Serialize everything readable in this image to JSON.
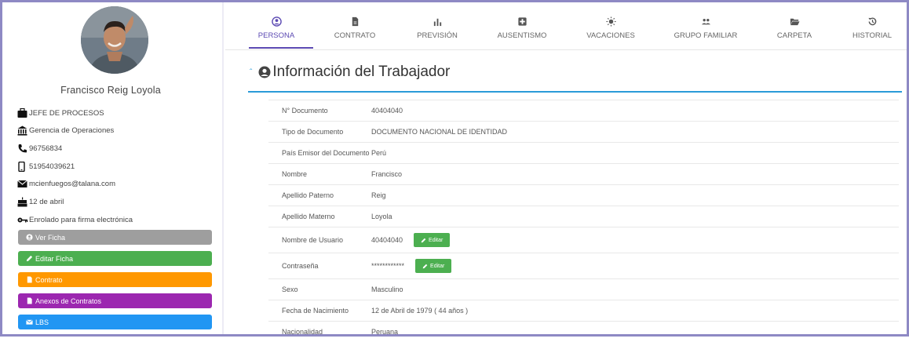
{
  "profile": {
    "name": "Francisco Reig Loyola",
    "info": [
      {
        "icon": "briefcase-icon",
        "text": "JEFE DE PROCESOS"
      },
      {
        "icon": "bank-icon",
        "text": "Gerencia de Operaciones"
      },
      {
        "icon": "phone-icon",
        "text": "96756834"
      },
      {
        "icon": "mobile-icon",
        "text": "51954039621"
      },
      {
        "icon": "envelope-icon",
        "text": "mcienfuegos@talana.com"
      },
      {
        "icon": "cake-icon",
        "text": "12 de abril"
      },
      {
        "icon": "key-icon",
        "text": "Enrolado para firma electrónica"
      }
    ],
    "buttons": [
      {
        "label": "Ver Ficha",
        "icon": "user-circle-icon",
        "color": "#9e9e9e"
      },
      {
        "label": "Editar Ficha",
        "icon": "pencil-icon",
        "color": "#4caf50"
      },
      {
        "label": "Contrato",
        "icon": "document-icon",
        "color": "#ff9800"
      },
      {
        "label": "Anexos de Contratos",
        "icon": "document-icon",
        "color": "#9c27b0"
      },
      {
        "label": "LBS",
        "icon": "envelope-icon",
        "color": "#2196f3"
      }
    ]
  },
  "tabs": [
    {
      "label": "PERSONA",
      "icon": "user-circle-icon",
      "active": true
    },
    {
      "label": "CONTRATO",
      "icon": "document-icon",
      "active": false
    },
    {
      "label": "PREVISIÓN",
      "icon": "bar-chart-icon",
      "active": false
    },
    {
      "label": "AUSENTISMO",
      "icon": "medical-plus-icon",
      "active": false
    },
    {
      "label": "VACACIONES",
      "icon": "sun-icon",
      "active": false
    },
    {
      "label": "GRUPO FAMILIAR",
      "icon": "family-icon",
      "active": false
    },
    {
      "label": "CARPETA",
      "icon": "folder-open-icon",
      "active": false
    },
    {
      "label": "HISTORIAL",
      "icon": "history-icon",
      "active": false
    }
  ],
  "section": {
    "caret": "ˆ",
    "title": "Información del Trabajador"
  },
  "details": [
    {
      "label": "N° Documento",
      "value": "40404040"
    },
    {
      "label": "Tipo de Documento",
      "value": "DOCUMENTO NACIONAL DE IDENTIDAD"
    },
    {
      "label": "País Emisor del Documento",
      "value": "Perú"
    },
    {
      "label": "Nombre",
      "value": "Francisco"
    },
    {
      "label": "Apellido Paterno",
      "value": "Reig"
    },
    {
      "label": "Apellido Materno",
      "value": "Loyola"
    },
    {
      "label": "Nombre de Usuario",
      "value": "40404040",
      "action": "Editar"
    },
    {
      "label": "Contraseña",
      "value": "************",
      "action": "Editar"
    },
    {
      "label": "Sexo",
      "value": "Masculino"
    },
    {
      "label": "Fecha de Nacimiento",
      "value": "12 de Abril de 1979 ( 44 años )"
    },
    {
      "label": "Nacionalidad",
      "value": "Peruana"
    }
  ],
  "colors": {
    "accent": "#5c4ab3",
    "section_line": "#2a9bd8",
    "edit_button": "#4caf50"
  }
}
